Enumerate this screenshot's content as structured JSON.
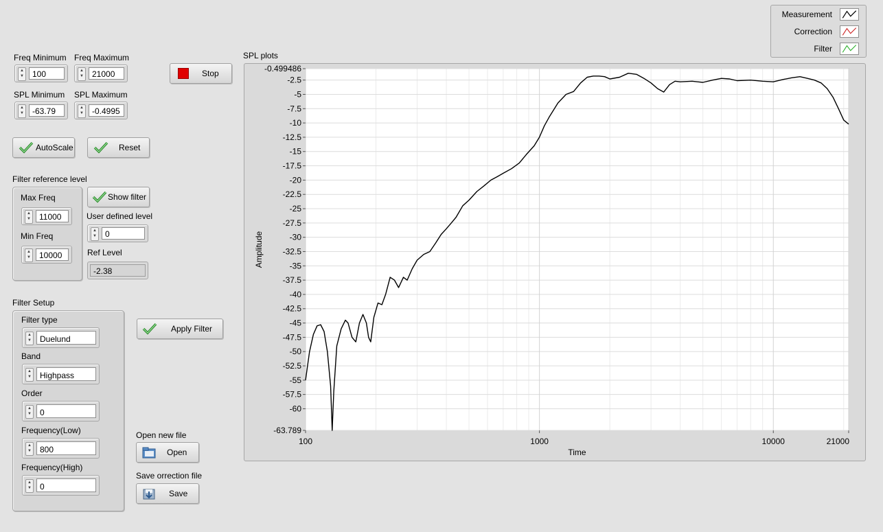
{
  "controls": {
    "freq_min": {
      "label": "Freq Minimum",
      "value": "100"
    },
    "freq_max": {
      "label": "Freq Maximum",
      "value": "21000"
    },
    "spl_min": {
      "label": "SPL Minimum",
      "value": "-63.79"
    },
    "spl_max": {
      "label": "SPL Maximum",
      "value": "-0.4995"
    },
    "stop_label": "Stop",
    "autoscale_label": "AutoScale",
    "reset_label": "Reset"
  },
  "filter_ref": {
    "title": "Filter reference level",
    "max_freq": {
      "label": "Max Freq",
      "value": "11000"
    },
    "min_freq": {
      "label": "Min Freq",
      "value": "10000"
    },
    "show_filter_label": "Show filter",
    "user_level": {
      "label": "User defined level",
      "value": "0"
    },
    "ref_level": {
      "label": "Ref Level",
      "value": "-2.38"
    }
  },
  "filter_setup": {
    "title": "Filter Setup",
    "type": {
      "label": "Filter type",
      "value": "Duelund"
    },
    "band": {
      "label": "Band",
      "value": "Highpass"
    },
    "order": {
      "label": "Order",
      "value": "0"
    },
    "freq_low": {
      "label": "Frequency(Low)",
      "value": "800"
    },
    "freq_high": {
      "label": "Frequency(High)",
      "value": "0"
    },
    "apply_label": "Apply Filter"
  },
  "files": {
    "open_caption": "Open new file",
    "open_label": "Open",
    "save_caption": "Save orrection file",
    "save_label": "Save"
  },
  "legend": [
    {
      "name": "Measurement",
      "color": "#000000"
    },
    {
      "name": "Correction",
      "color": "#cc2020"
    },
    {
      "name": "Filter",
      "color": "#2ab02a"
    }
  ],
  "chart_data": {
    "type": "line",
    "title": "SPL plots",
    "xlabel": "Time",
    "ylabel": "Amplitude",
    "x_scale": "log",
    "xlim": [
      100,
      21000
    ],
    "ylim": [
      -63.789,
      -0.499486
    ],
    "x_ticks": [
      "100",
      "1000",
      "10000",
      "21000"
    ],
    "y_ticks": [
      "-0.499486",
      "-2.5",
      "-5",
      "-7.5",
      "-10",
      "-12.5",
      "-15",
      "-17.5",
      "-20",
      "-22.5",
      "-25",
      "-27.5",
      "-30",
      "-32.5",
      "-35",
      "-37.5",
      "-40",
      "-42.5",
      "-45",
      "-47.5",
      "-50",
      "-52.5",
      "-55",
      "-57.5",
      "-60",
      "-63.789"
    ],
    "grid": true,
    "series": [
      {
        "name": "Measurement",
        "color": "#000000",
        "x": [
          100,
          104,
          108,
          112,
          116,
          120,
          124,
          128,
          129,
          130,
          132,
          136,
          142,
          148,
          152,
          158,
          164,
          170,
          176,
          182,
          186,
          190,
          196,
          204,
          212,
          220,
          230,
          240,
          250,
          262,
          272,
          286,
          300,
          320,
          340,
          360,
          380,
          400,
          420,
          440,
          470,
          500,
          540,
          580,
          620,
          660,
          700,
          760,
          820,
          880,
          950,
          1000,
          1050,
          1100,
          1200,
          1300,
          1400,
          1500,
          1600,
          1700,
          1800,
          1900,
          2000,
          2200,
          2400,
          2600,
          2800,
          3000,
          3200,
          3400,
          3600,
          3800,
          4000,
          4500,
          5000,
          5500,
          6000,
          6500,
          7000,
          8000,
          9000,
          10000,
          11000,
          12000,
          13000,
          14000,
          15000,
          16000,
          17000,
          18000,
          19000,
          20000,
          21000
        ],
        "y": [
          -55,
          -50,
          -47,
          -45.5,
          -45.3,
          -46.5,
          -50,
          -56,
          -60,
          -63.8,
          -57,
          -49,
          -46,
          -44.5,
          -45,
          -47.5,
          -48.3,
          -45,
          -43.5,
          -45,
          -47.5,
          -48.3,
          -44,
          -41.5,
          -41.8,
          -40,
          -37,
          -37.5,
          -38.8,
          -37,
          -37.5,
          -35.5,
          -34,
          -33,
          -32.5,
          -31,
          -29.5,
          -28.5,
          -27.5,
          -26.5,
          -24.5,
          -23.5,
          -22,
          -21,
          -20,
          -19.4,
          -18.8,
          -18,
          -17,
          -15.5,
          -14,
          -12.5,
          -10.5,
          -9,
          -6.5,
          -5,
          -4.5,
          -3,
          -2,
          -1.8,
          -1.8,
          -1.9,
          -2.3,
          -2,
          -1.3,
          -1.5,
          -2.2,
          -3,
          -4,
          -4.6,
          -3.3,
          -2.7,
          -2.8,
          -2.7,
          -2.9,
          -2.5,
          -2.2,
          -2.3,
          -2.6,
          -2.5,
          -2.7,
          -2.8,
          -2.4,
          -2.1,
          -1.9,
          -2.2,
          -2.5,
          -3,
          -4,
          -5.5,
          -7.5,
          -9.5,
          -10.2
        ]
      }
    ]
  }
}
